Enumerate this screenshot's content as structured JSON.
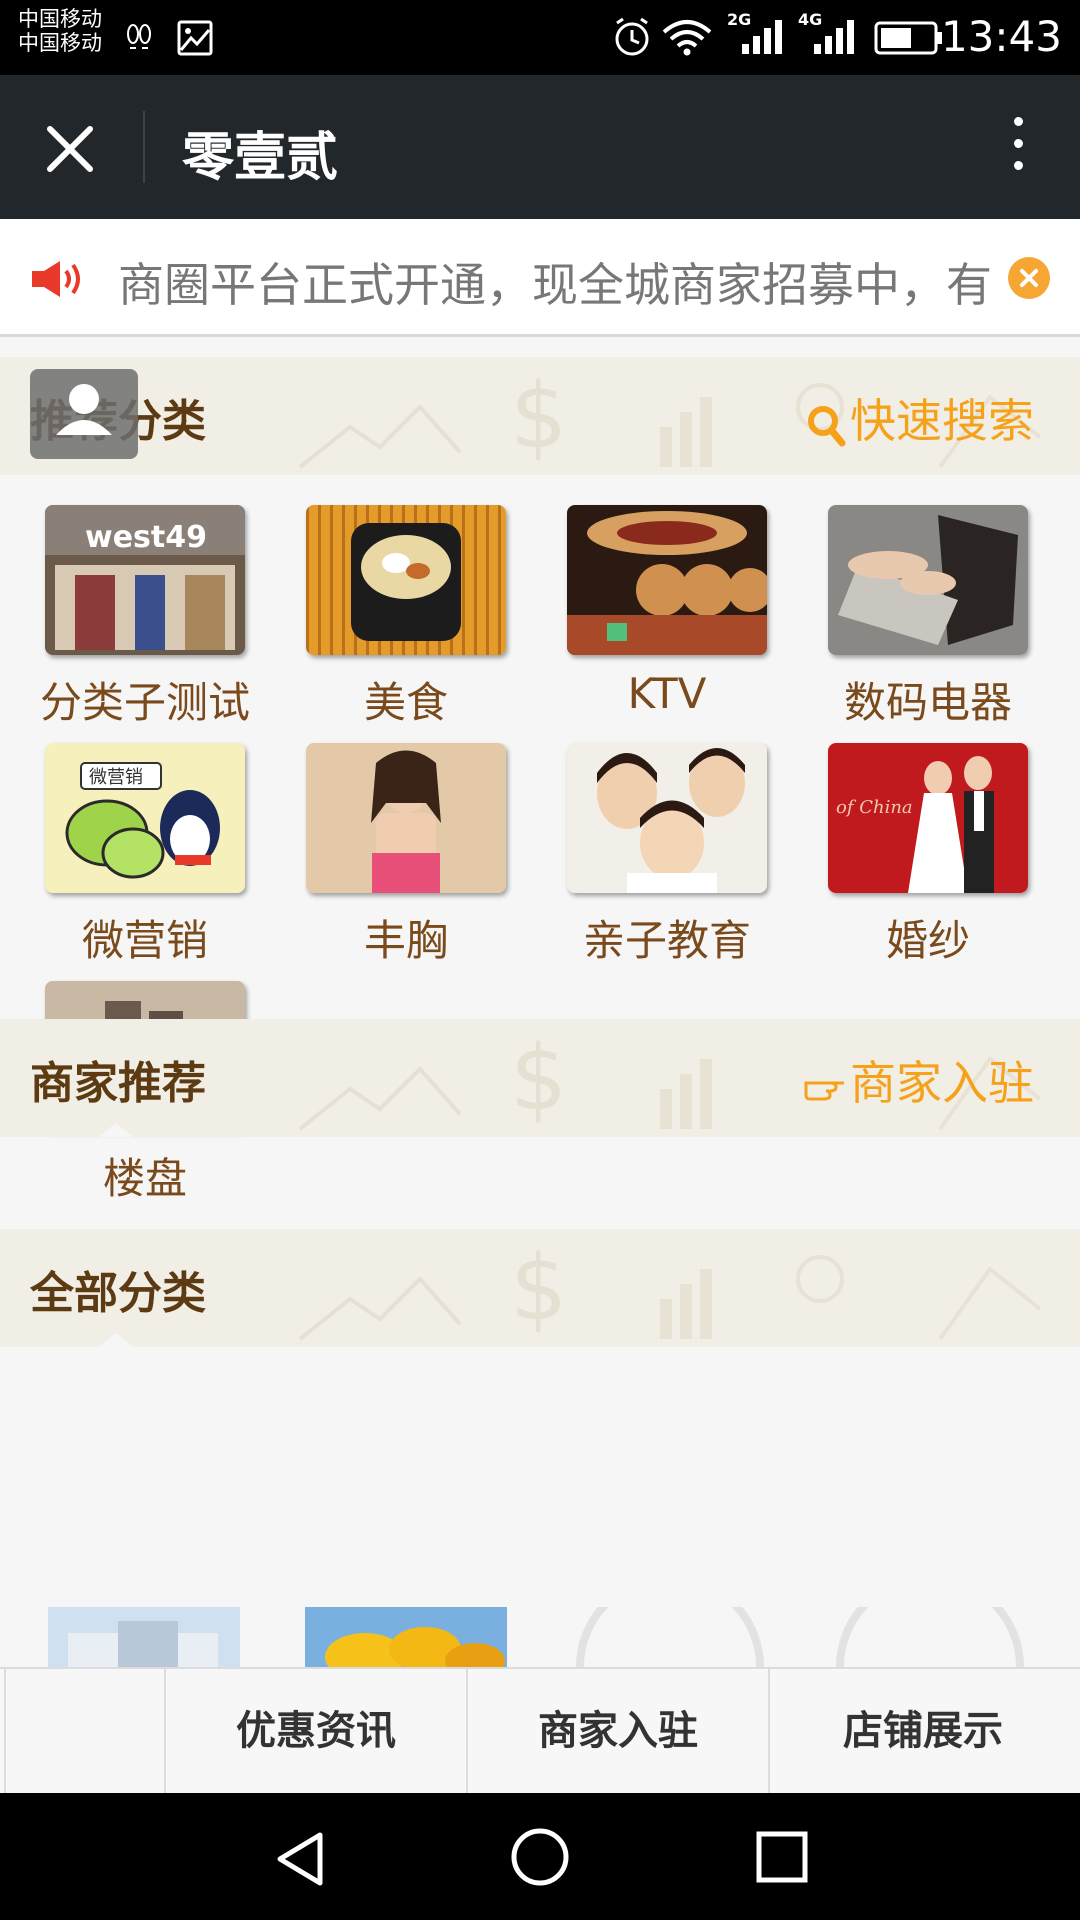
{
  "status_bar": {
    "carrier_1": "中国移动",
    "carrier_2": "中国移动",
    "network_2g": "2G",
    "network_4g": "4G",
    "time": "13:43"
  },
  "header": {
    "title": "零壹贰"
  },
  "notice": {
    "text": "商圈平台正式开通，现全城商家招募中，有"
  },
  "sections": {
    "recommended": {
      "title": "推荐分类",
      "link": "快速搜索"
    },
    "merchants": {
      "title": "商家推荐",
      "link": "商家入驻"
    },
    "all": {
      "title": "全部分类"
    }
  },
  "categories": [
    {
      "label": "分类子测试",
      "icon": "storefront-photo"
    },
    {
      "label": "美食",
      "icon": "noodle-bowl-photo"
    },
    {
      "label": "KTV",
      "icon": "ktv-room-photo"
    },
    {
      "label": "数码电器",
      "icon": "laptop-photo"
    },
    {
      "label": "微营销",
      "icon": "wechat-qq-photo"
    },
    {
      "label": "丰胸",
      "icon": "woman-photo"
    },
    {
      "label": "亲子教育",
      "icon": "parent-child-photo"
    },
    {
      "label": "婚纱",
      "icon": "wedding-photo"
    },
    {
      "label": "楼盘",
      "icon": "buildings-photo"
    }
  ],
  "tabbar": {
    "tabs": [
      "优惠资讯",
      "商家入驻",
      "店铺展示"
    ]
  },
  "colors": {
    "accent": "#f6a11a",
    "section_title": "#5c3a12",
    "header_bg": "#22272b"
  }
}
